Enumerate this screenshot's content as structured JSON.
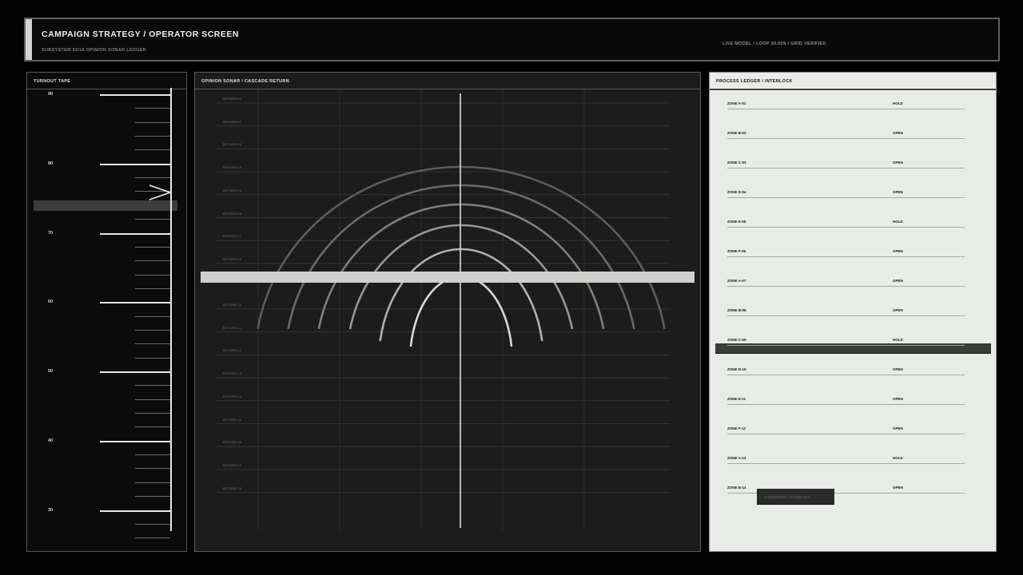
{
  "header": {
    "title": "CAMPAIGN STRATEGY / OPERATOR SCREEN",
    "subtitle": "SUBSYSTEM 02/18  OPINION SONAR LEDGER",
    "model": "LIVE MODEL / LOOP 30.00S / GRID VERIFIED"
  },
  "tape": {
    "title": "TURNOUT TAPE",
    "labels": [
      "90",
      "80",
      "70",
      "60",
      "50",
      "40",
      "30"
    ],
    "pointer_icon": "chevron-left-pointer"
  },
  "sonar": {
    "title": "OPINION SONAR / CASCADE RETURN",
    "returns_upper": [
      "RETURN 01",
      "RETURN 02",
      "RETURN 03",
      "RETURN 04",
      "RETURN 05",
      "RETURN 06",
      "RETURN 07",
      "RETURN 08"
    ],
    "returns_lower": [
      "RETURN 10",
      "RETURN 11",
      "RETURN 12",
      "RETURN 13",
      "RETURN 14",
      "RETURN 15",
      "RETURN 16",
      "RETURN 17",
      "RETURN 18"
    ]
  },
  "ledger": {
    "title": "PROCESS LEDGER / INTERLOCK",
    "rows": [
      {
        "zone": "ZONE A-01",
        "status": "HOLD"
      },
      {
        "zone": "ZONE B-02",
        "status": "OPEN"
      },
      {
        "zone": "ZONE C-03",
        "status": "OPEN"
      },
      {
        "zone": "ZONE D-04",
        "status": "OPEN"
      },
      {
        "zone": "ZONE E-05",
        "status": "HOLD"
      },
      {
        "zone": "ZONE F-06",
        "status": "OPEN"
      },
      {
        "zone": "ZONE A-07",
        "status": "OPEN"
      },
      {
        "zone": "ZONE B-08",
        "status": "OPEN"
      },
      {
        "zone": "ZONE C-09",
        "status": "HOLD"
      },
      {
        "zone": "ZONE D-10",
        "status": "OPEN"
      },
      {
        "zone": "ZONE E-11",
        "status": "OPEN"
      },
      {
        "zone": "ZONE F-12",
        "status": "OPEN"
      },
      {
        "zone": "ZONE A-13",
        "status": "HOLD"
      },
      {
        "zone": "ZONE B-14",
        "status": "OPEN"
      }
    ],
    "chip": "CONSENSUS / INTERLOCK"
  },
  "colors": {
    "background": "#020202",
    "panel_dark": "#0b0b0b",
    "sonar_bg": "#1b1c1b",
    "ledger_bg": "#e9ebe7",
    "accent_light": "#d2d4d0"
  }
}
